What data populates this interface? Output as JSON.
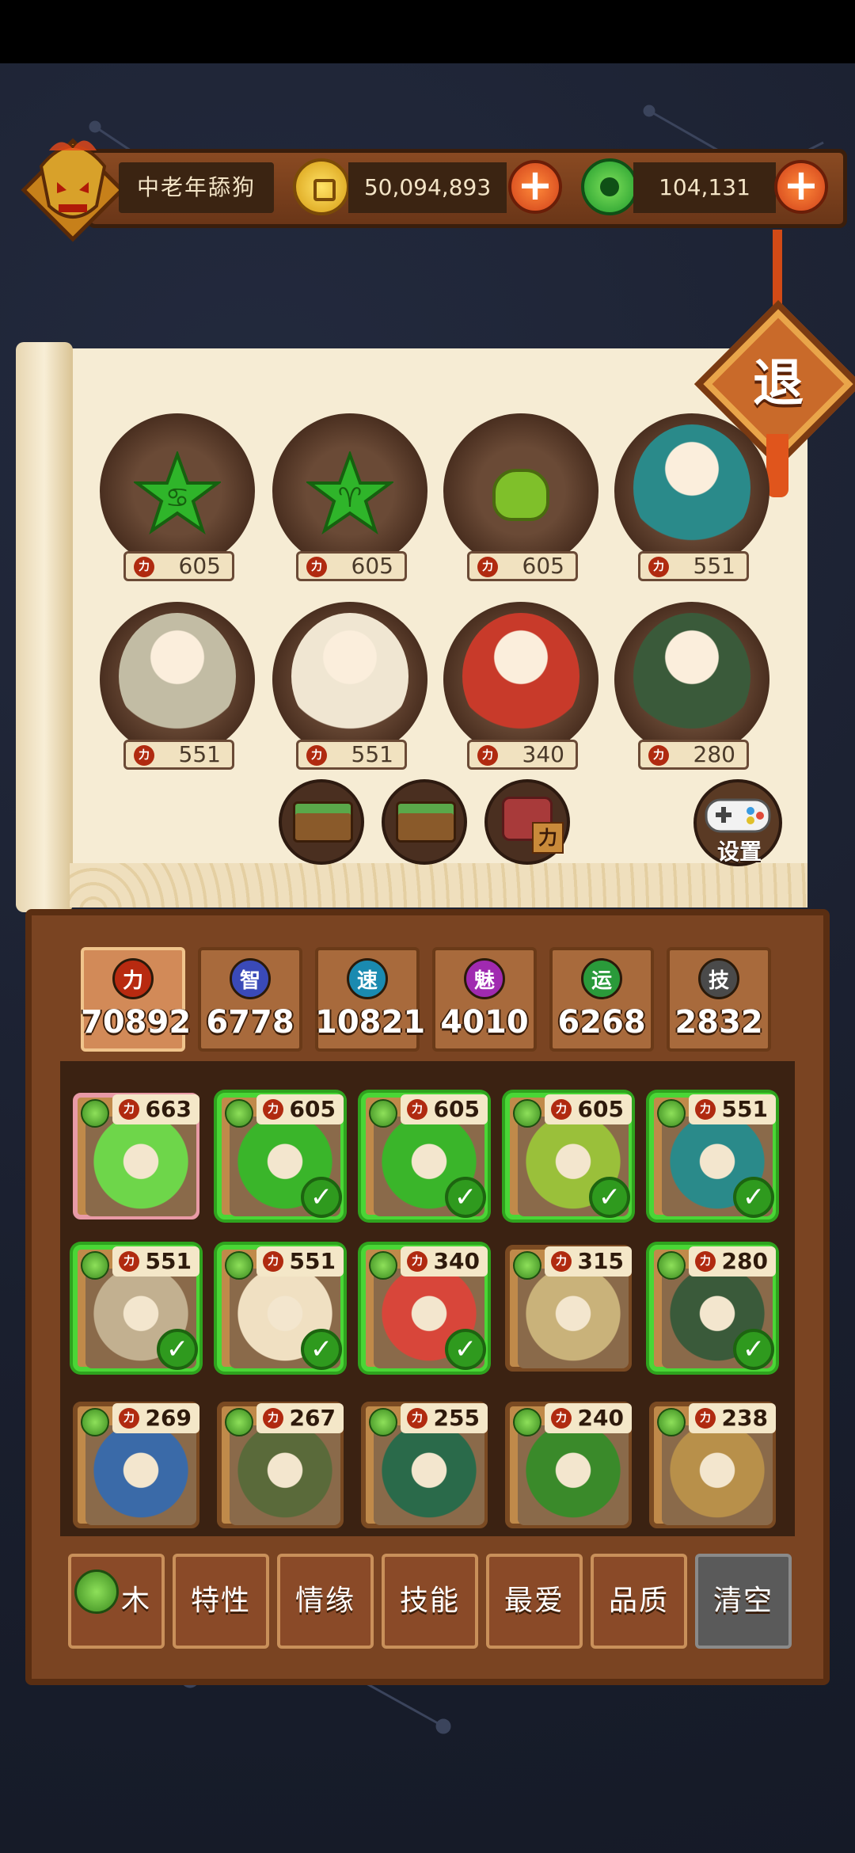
{
  "header": {
    "player_name": "中老年舔狗",
    "gold": "50,094,893",
    "jade": "104,131",
    "exit_label": "退"
  },
  "team_slots": [
    {
      "power": "605",
      "kind": "star-monster",
      "color": "#2fb52a",
      "glyph": "♋"
    },
    {
      "power": "605",
      "kind": "star-monster",
      "color": "#2fb52a",
      "glyph": "♈"
    },
    {
      "power": "605",
      "kind": "jar-monster",
      "color": "#7fc02a",
      "glyph": ""
    },
    {
      "power": "551",
      "kind": "hero",
      "color": "#2a8a8a"
    },
    {
      "power": "551",
      "kind": "hero",
      "color": "#c2bca4"
    },
    {
      "power": "551",
      "kind": "hero",
      "color": "#f0e6d2"
    },
    {
      "power": "340",
      "kind": "hero",
      "color": "#c83a2a"
    },
    {
      "power": "280",
      "kind": "hero",
      "color": "#3a5a3a"
    }
  ],
  "extra_slots": [
    {
      "name": "food-box-1"
    },
    {
      "name": "food-box-2"
    },
    {
      "name": "power-drum",
      "label": "力"
    }
  ],
  "settings_label": "设置",
  "stats": [
    {
      "icon": "力",
      "value": "70892",
      "color": "#b82a10",
      "active": true
    },
    {
      "icon": "智",
      "value": "6778",
      "color": "#3a4ab8"
    },
    {
      "icon": "速",
      "value": "10821",
      "color": "#1a8ab0"
    },
    {
      "icon": "魅",
      "value": "4010",
      "color": "#a02ab0"
    },
    {
      "icon": "运",
      "value": "6268",
      "color": "#2a9a3a"
    },
    {
      "icon": "技",
      "value": "2832",
      "color": "#4a4a4a"
    }
  ],
  "cards": [
    {
      "power": "663",
      "selected": false,
      "first": true,
      "color": "#6ed64a"
    },
    {
      "power": "605",
      "selected": true,
      "color": "#3ab52a"
    },
    {
      "power": "605",
      "selected": true,
      "color": "#3ab52a"
    },
    {
      "power": "605",
      "selected": true,
      "color": "#9ac03a"
    },
    {
      "power": "551",
      "selected": true,
      "color": "#2a8a8a"
    },
    {
      "power": "551",
      "selected": true,
      "color": "#c2b090"
    },
    {
      "power": "551",
      "selected": true,
      "color": "#f0e0c2"
    },
    {
      "power": "340",
      "selected": true,
      "color": "#d8463a"
    },
    {
      "power": "315",
      "selected": false,
      "color": "#c9b27a"
    },
    {
      "power": "280",
      "selected": true,
      "color": "#3a5a3a"
    },
    {
      "power": "269",
      "selected": false,
      "color": "#3a6aa8"
    },
    {
      "power": "267",
      "selected": false,
      "color": "#5a6a3a"
    },
    {
      "power": "255",
      "selected": false,
      "color": "#2a6a4a"
    },
    {
      "power": "240",
      "selected": false,
      "color": "#3a8a2a"
    },
    {
      "power": "238",
      "selected": false,
      "color": "#b8904a"
    }
  ],
  "filters": [
    "木",
    "特性",
    "情缘",
    "技能",
    "最爱",
    "品质",
    "清空"
  ]
}
